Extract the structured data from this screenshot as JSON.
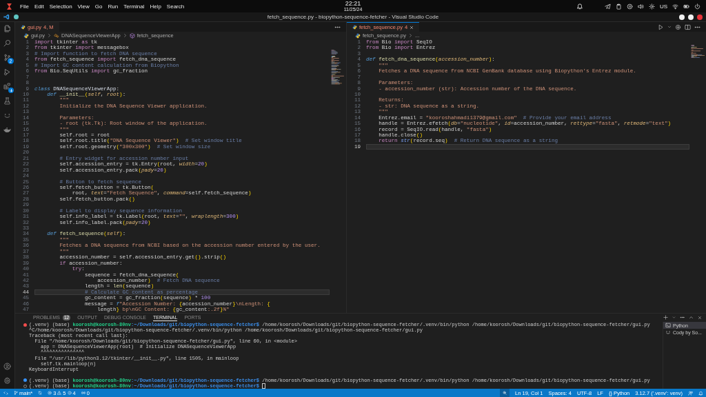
{
  "system_bar": {
    "menu": [
      "File",
      "Edit",
      "Selection",
      "View",
      "Go",
      "Run",
      "Terminal",
      "Help",
      "Search"
    ],
    "time": "22:21",
    "date": "11/25/24",
    "keyboard_layout": "US"
  },
  "window": {
    "title": "fetch_sequence.py - biopython-sequence-fetcher - Visual Studio Code"
  },
  "activity_bar": {
    "top": [
      {
        "kind": "files",
        "notice": false
      },
      {
        "kind": "search",
        "notice": false
      },
      {
        "kind": "source-control",
        "badge": "2",
        "notice": false
      },
      {
        "kind": "run-debug",
        "notice": false
      },
      {
        "kind": "extensions",
        "notice": true
      },
      {
        "kind": "testing",
        "notice": false
      },
      {
        "kind": "cody",
        "notice": false
      },
      {
        "kind": "docker",
        "notice": false
      }
    ],
    "bottom": [
      {
        "kind": "account"
      },
      {
        "kind": "settings"
      }
    ]
  },
  "editors": [
    {
      "focused": false,
      "tab": {
        "label": "gui.py",
        "status": "4, M",
        "has_errors": true
      },
      "actions": [
        {
          "kind": "more"
        }
      ],
      "breadcrumbs": [
        {
          "kind": "file",
          "text": "gui.py"
        },
        {
          "kind": "class",
          "text": "DNASequenceViewerApp"
        },
        {
          "kind": "method",
          "text": "fetch_sequence"
        }
      ],
      "lines": [
        {
          "number": "1",
          "current": false,
          "tokens": [
            {
              "kind": "kw",
              "text": "import"
            },
            {
              "kind": "txt",
              "text": " tkinter "
            },
            {
              "kind": "kw",
              "text": "as"
            },
            {
              "kind": "txt",
              "text": " tk"
            }
          ]
        },
        {
          "number": "2",
          "current": false,
          "tokens": [
            {
              "kind": "kw",
              "text": "from"
            },
            {
              "kind": "txt",
              "text": " tkinter "
            },
            {
              "kind": "kw",
              "text": "import"
            },
            {
              "kind": "txt",
              "text": " messagebox"
            }
          ]
        },
        {
          "number": "3",
          "current": false,
          "tokens": [
            {
              "kind": "com",
              "text": "# Import function to fetch DNA sequence"
            }
          ]
        },
        {
          "number": "4",
          "current": false,
          "tokens": [
            {
              "kind": "kw",
              "text": "from"
            },
            {
              "kind": "txt",
              "text": " fetch_sequence "
            },
            {
              "kind": "kw",
              "text": "import"
            },
            {
              "kind": "txt",
              "text": " fetch_dna_sequence"
            }
          ]
        },
        {
          "number": "5",
          "current": false,
          "tokens": [
            {
              "kind": "com",
              "text": "# Import GC content calculation from Biopython"
            }
          ]
        },
        {
          "number": "6",
          "current": false,
          "tokens": [
            {
              "kind": "kw",
              "text": "from"
            },
            {
              "kind": "txt",
              "text": " Bio.SeqUtils "
            },
            {
              "kind": "kw",
              "text": "import"
            },
            {
              "kind": "txt",
              "text": " gc_fraction"
            }
          ]
        },
        {
          "number": "7",
          "current": false
        },
        {
          "number": "8",
          "current": false
        },
        {
          "number": "9",
          "current": false,
          "tokens": [
            {
              "kind": "def",
              "text": "class"
            },
            {
              "kind": "cls",
              "text": " DNASequenceViewerApp"
            },
            {
              "kind": "txt",
              "text": ":"
            }
          ]
        },
        {
          "number": "10",
          "current": false,
          "tokens": [
            {
              "kind": "def",
              "text": "    def"
            },
            {
              "kind": "fn",
              "text": " __init__"
            },
            {
              "kind": "br",
              "text": "("
            },
            {
              "kind": "param",
              "text": "self"
            },
            {
              "kind": "txt",
              "text": ", "
            },
            {
              "kind": "param",
              "text": "root"
            },
            {
              "kind": "br",
              "text": ")"
            },
            {
              "kind": "txt",
              "text": ":"
            }
          ]
        },
        {
          "number": "11",
          "current": false,
          "tokens": [
            {
              "kind": "str",
              "text": "        \"\"\""
            }
          ]
        },
        {
          "number": "12",
          "current": false,
          "tokens": [
            {
              "kind": "str",
              "text": "        Initialize the DNA Sequence Viewer application."
            }
          ]
        },
        {
          "number": "13",
          "current": false
        },
        {
          "number": "14",
          "current": false,
          "tokens": [
            {
              "kind": "str",
              "text": "        Parameters:"
            }
          ]
        },
        {
          "number": "15",
          "current": false,
          "tokens": [
            {
              "kind": "str",
              "text": "        - root (tk.Tk): Root window of the application."
            }
          ]
        },
        {
          "number": "16",
          "current": false,
          "tokens": [
            {
              "kind": "str",
              "text": "        \"\"\""
            }
          ]
        },
        {
          "number": "17",
          "current": false,
          "tokens": [
            {
              "kind": "txt",
              "text": "        self.root = root"
            }
          ]
        },
        {
          "number": "18",
          "current": false,
          "tokens": [
            {
              "kind": "txt",
              "text": "        self.root.title"
            },
            {
              "kind": "br",
              "text": "("
            },
            {
              "kind": "str",
              "text": "\"DNA Sequence Viewer\""
            },
            {
              "kind": "br",
              "text": ")"
            },
            {
              "kind": "com",
              "text": "  # Set window title"
            }
          ]
        },
        {
          "number": "19",
          "current": false,
          "tokens": [
            {
              "kind": "txt",
              "text": "        self.root.geometry"
            },
            {
              "kind": "br",
              "text": "("
            },
            {
              "kind": "str",
              "text": "\"300x300\""
            },
            {
              "kind": "br",
              "text": ")"
            },
            {
              "kind": "com",
              "text": "  # Set window size"
            }
          ]
        },
        {
          "number": "20",
          "current": false
        },
        {
          "number": "21",
          "current": false,
          "tokens": [
            {
              "kind": "com",
              "text": "        # Entry widget for accession number input"
            }
          ]
        },
        {
          "number": "22",
          "current": false,
          "tokens": [
            {
              "kind": "txt",
              "text": "        self.accession_entry = tk.Entry"
            },
            {
              "kind": "br",
              "text": "("
            },
            {
              "kind": "txt",
              "text": "root, "
            },
            {
              "kind": "param",
              "text": "width"
            },
            {
              "kind": "txt",
              "text": "="
            },
            {
              "kind": "num",
              "text": "20"
            },
            {
              "kind": "br",
              "text": ")"
            }
          ]
        },
        {
          "number": "23",
          "current": false,
          "tokens": [
            {
              "kind": "txt",
              "text": "        self.accession_entry.pack"
            },
            {
              "kind": "br",
              "text": "("
            },
            {
              "kind": "param",
              "text": "pady"
            },
            {
              "kind": "txt",
              "text": "="
            },
            {
              "kind": "num",
              "text": "20"
            },
            {
              "kind": "br",
              "text": ")"
            }
          ]
        },
        {
          "number": "24",
          "current": false
        },
        {
          "number": "25",
          "current": false,
          "tokens": [
            {
              "kind": "com",
              "text": "        # Button to fetch sequence"
            }
          ]
        },
        {
          "number": "26",
          "current": false,
          "tokens": [
            {
              "kind": "txt",
              "text": "        self.fetch_button = tk.Button"
            },
            {
              "kind": "br",
              "text": "("
            }
          ]
        },
        {
          "number": "27",
          "current": false,
          "tokens": [
            {
              "kind": "txt",
              "text": "            root, "
            },
            {
              "kind": "param",
              "text": "text"
            },
            {
              "kind": "txt",
              "text": "="
            },
            {
              "kind": "str",
              "text": "\"Fetch Sequence\""
            },
            {
              "kind": "txt",
              "text": ", "
            },
            {
              "kind": "param",
              "text": "command"
            },
            {
              "kind": "txt",
              "text": "=self.fetch_sequence"
            },
            {
              "kind": "br",
              "text": ")"
            }
          ]
        },
        {
          "number": "28",
          "current": false,
          "tokens": [
            {
              "kind": "txt",
              "text": "        self.fetch_button.pack"
            },
            {
              "kind": "br",
              "text": "()"
            }
          ]
        },
        {
          "number": "29",
          "current": false
        },
        {
          "number": "30",
          "current": false,
          "tokens": [
            {
              "kind": "com",
              "text": "        # Label to display sequence information"
            }
          ]
        },
        {
          "number": "31",
          "current": false,
          "tokens": [
            {
              "kind": "txt",
              "text": "        self.info_label = tk.Label"
            },
            {
              "kind": "br",
              "text": "("
            },
            {
              "kind": "txt",
              "text": "root, "
            },
            {
              "kind": "param",
              "text": "text"
            },
            {
              "kind": "txt",
              "text": "="
            },
            {
              "kind": "str",
              "text": "\"\""
            },
            {
              "kind": "txt",
              "text": ", "
            },
            {
              "kind": "param",
              "text": "wraplength"
            },
            {
              "kind": "txt",
              "text": "="
            },
            {
              "kind": "num",
              "text": "300"
            },
            {
              "kind": "br",
              "text": ")"
            }
          ]
        },
        {
          "number": "32",
          "current": false,
          "tokens": [
            {
              "kind": "txt",
              "text": "        self.info_label.pack"
            },
            {
              "kind": "br",
              "text": "("
            },
            {
              "kind": "param",
              "text": "pady"
            },
            {
              "kind": "txt",
              "text": "="
            },
            {
              "kind": "num",
              "text": "20"
            },
            {
              "kind": "br",
              "text": ")"
            }
          ]
        },
        {
          "number": "33",
          "current": false
        },
        {
          "number": "34",
          "current": false,
          "tokens": [
            {
              "kind": "def",
              "text": "    def"
            },
            {
              "kind": "fn",
              "text": " fetch_sequence"
            },
            {
              "kind": "br",
              "text": "("
            },
            {
              "kind": "param",
              "text": "self"
            },
            {
              "kind": "br",
              "text": ")"
            },
            {
              "kind": "txt",
              "text": ":"
            }
          ]
        },
        {
          "number": "35",
          "current": false,
          "tokens": [
            {
              "kind": "str",
              "text": "        \"\"\""
            }
          ]
        },
        {
          "number": "36",
          "current": false,
          "tokens": [
            {
              "kind": "str",
              "text": "        Fetches a DNA sequence from NCBI based on the accession number entered by the user."
            }
          ]
        },
        {
          "number": "37",
          "current": false,
          "tokens": [
            {
              "kind": "str",
              "text": "        \"\"\""
            }
          ]
        },
        {
          "number": "38",
          "current": false,
          "tokens": [
            {
              "kind": "txt",
              "text": "        accession_number = self.accession_entry.get"
            },
            {
              "kind": "br",
              "text": "()"
            },
            {
              "kind": "txt",
              "text": ".strip"
            },
            {
              "kind": "br",
              "text": "()"
            }
          ]
        },
        {
          "number": "39",
          "current": false,
          "tokens": [
            {
              "kind": "kw",
              "text": "        if"
            },
            {
              "kind": "txt",
              "text": " accession_number:"
            }
          ]
        },
        {
          "number": "40",
          "current": false,
          "tokens": [
            {
              "kind": "kw",
              "text": "            try"
            },
            {
              "kind": "txt",
              "text": ":"
            }
          ]
        },
        {
          "number": "41",
          "current": false,
          "tokens": [
            {
              "kind": "txt",
              "text": "                sequence = fetch_dna_sequence"
            },
            {
              "kind": "br",
              "text": "("
            }
          ]
        },
        {
          "number": "42",
          "current": false,
          "tokens": [
            {
              "kind": "txt",
              "text": "                    accession_number"
            },
            {
              "kind": "br",
              "text": ")"
            },
            {
              "kind": "com",
              "text": "  # Fetch DNA sequence"
            }
          ]
        },
        {
          "number": "43",
          "current": false,
          "tokens": [
            {
              "kind": "txt",
              "text": "                length = "
            },
            {
              "kind": "fn",
              "text": "len"
            },
            {
              "kind": "br",
              "text": "("
            },
            {
              "kind": "txt",
              "text": "sequence"
            },
            {
              "kind": "br",
              "text": ")"
            }
          ]
        },
        {
          "number": "44",
          "current": true,
          "tokens": [
            {
              "kind": "com",
              "text": "                # Calculate GC content as percentage"
            }
          ]
        },
        {
          "number": "45",
          "current": false,
          "tokens": [
            {
              "kind": "txt",
              "text": "                gc_content = gc_fraction"
            },
            {
              "kind": "br",
              "text": "("
            },
            {
              "kind": "txt",
              "text": "sequence"
            },
            {
              "kind": "br",
              "text": ")"
            },
            {
              "kind": "txt",
              "text": " * "
            },
            {
              "kind": "num",
              "text": "100"
            }
          ]
        },
        {
          "number": "46",
          "current": false,
          "tokens": [
            {
              "kind": "txt",
              "text": "                message = "
            },
            {
              "kind": "def",
              "text": "f"
            },
            {
              "kind": "str",
              "text": "\"Accession Number: "
            },
            {
              "kind": "br",
              "text": "{"
            },
            {
              "kind": "txt",
              "text": "accession_number"
            },
            {
              "kind": "br",
              "text": "}"
            },
            {
              "kind": "str",
              "text": "\\nLength: "
            },
            {
              "kind": "br",
              "text": "{"
            }
          ]
        },
        {
          "number": "47",
          "current": false,
          "tokens": [
            {
              "kind": "txt",
              "text": "                    length"
            },
            {
              "kind": "br",
              "text": "}"
            },
            {
              "kind": "str",
              "text": " bp\\nGC Content: "
            },
            {
              "kind": "br",
              "text": "{"
            },
            {
              "kind": "txt",
              "text": "gc_content"
            },
            {
              "kind": "str",
              "text": ":.2f"
            },
            {
              "kind": "br",
              "text": "}"
            },
            {
              "kind": "str",
              "text": "%\""
            }
          ]
        }
      ]
    },
    {
      "focused": true,
      "tab": {
        "label": "fetch_sequence.py",
        "status": "4",
        "has_errors": true
      },
      "actions": [
        {
          "kind": "run"
        },
        {
          "kind": "caret"
        },
        {
          "kind": "compare"
        },
        {
          "kind": "split"
        },
        {
          "kind": "more"
        }
      ],
      "breadcrumbs": [
        {
          "kind": "file",
          "text": "fetch_sequence.py"
        },
        {
          "kind": "more",
          "text": "..."
        }
      ],
      "lines": [
        {
          "number": "1",
          "current": false,
          "tokens": [
            {
              "kind": "kw",
              "text": "from"
            },
            {
              "kind": "txt",
              "text": " Bio "
            },
            {
              "kind": "kw",
              "text": "import"
            },
            {
              "kind": "txt",
              "text": " SeqIO"
            }
          ]
        },
        {
          "number": "2",
          "current": false,
          "tokens": [
            {
              "kind": "kw",
              "text": "from"
            },
            {
              "kind": "txt",
              "text": " Bio "
            },
            {
              "kind": "kw",
              "text": "import"
            },
            {
              "kind": "txt",
              "text": " Entrez"
            }
          ]
        },
        {
          "number": "3",
          "current": false
        },
        {
          "number": "4",
          "current": false,
          "tokens": [
            {
              "kind": "def",
              "text": "def"
            },
            {
              "kind": "fn",
              "text": " fetch_dna_sequence"
            },
            {
              "kind": "br",
              "text": "("
            },
            {
              "kind": "param",
              "text": "accession_number"
            },
            {
              "kind": "br",
              "text": ")"
            },
            {
              "kind": "txt",
              "text": ":"
            }
          ]
        },
        {
          "number": "5",
          "current": false,
          "tokens": [
            {
              "kind": "str",
              "text": "    \"\"\""
            }
          ]
        },
        {
          "number": "6",
          "current": false,
          "tokens": [
            {
              "kind": "str",
              "text": "    Fetches a DNA sequence from NCBI GenBank database using Biopython's Entrez module."
            }
          ]
        },
        {
          "number": "7",
          "current": false
        },
        {
          "number": "8",
          "current": false,
          "tokens": [
            {
              "kind": "str",
              "text": "    Parameters:"
            }
          ]
        },
        {
          "number": "9",
          "current": false,
          "tokens": [
            {
              "kind": "str",
              "text": "    - accession_number (str): Accession number of the DNA sequence."
            }
          ]
        },
        {
          "number": "10",
          "current": false
        },
        {
          "number": "11",
          "current": false,
          "tokens": [
            {
              "kind": "str",
              "text": "    Returns:"
            }
          ]
        },
        {
          "number": "12",
          "current": false,
          "tokens": [
            {
              "kind": "str",
              "text": "    - str: DNA sequence as a string."
            }
          ]
        },
        {
          "number": "13",
          "current": false,
          "tokens": [
            {
              "kind": "str",
              "text": "    \"\"\""
            }
          ]
        },
        {
          "number": "14",
          "current": false,
          "tokens": [
            {
              "kind": "txt",
              "text": "    Entrez.email = "
            },
            {
              "kind": "str",
              "text": "\"kooroshahmadi1379@gmail.com\""
            },
            {
              "kind": "com",
              "text": "  # Provide your email address"
            }
          ]
        },
        {
          "number": "15",
          "current": false,
          "tokens": [
            {
              "kind": "txt",
              "text": "    handle = Entrez.efetch"
            },
            {
              "kind": "br",
              "text": "("
            },
            {
              "kind": "param",
              "text": "db"
            },
            {
              "kind": "txt",
              "text": "="
            },
            {
              "kind": "str",
              "text": "\"nucleotide\""
            },
            {
              "kind": "txt",
              "text": ", "
            },
            {
              "kind": "param",
              "text": "id"
            },
            {
              "kind": "txt",
              "text": "=accession_number, "
            },
            {
              "kind": "param",
              "text": "rettype"
            },
            {
              "kind": "txt",
              "text": "="
            },
            {
              "kind": "str",
              "text": "\"fasta\""
            },
            {
              "kind": "txt",
              "text": ", "
            },
            {
              "kind": "param",
              "text": "retmode"
            },
            {
              "kind": "txt",
              "text": "="
            },
            {
              "kind": "str",
              "text": "\"text\""
            },
            {
              "kind": "br",
              "text": ")"
            }
          ]
        },
        {
          "number": "16",
          "current": false,
          "tokens": [
            {
              "kind": "txt",
              "text": "    record = SeqIO.read"
            },
            {
              "kind": "br",
              "text": "("
            },
            {
              "kind": "txt",
              "text": "handle, "
            },
            {
              "kind": "str",
              "text": "\"fasta\""
            },
            {
              "kind": "br",
              "text": ")"
            }
          ]
        },
        {
          "number": "17",
          "current": false,
          "tokens": [
            {
              "kind": "txt",
              "text": "    handle.close"
            },
            {
              "kind": "br",
              "text": "()"
            }
          ]
        },
        {
          "number": "18",
          "current": false,
          "tokens": [
            {
              "kind": "kw",
              "text": "    return"
            },
            {
              "kind": "builtin",
              "text": " str"
            },
            {
              "kind": "br",
              "text": "("
            },
            {
              "kind": "txt",
              "text": "record.seq"
            },
            {
              "kind": "br",
              "text": ")"
            },
            {
              "kind": "com",
              "text": "  # Return DNA sequence as a string"
            }
          ]
        },
        {
          "number": "19",
          "current": true
        }
      ]
    }
  ],
  "panel": {
    "tabs": [
      {
        "label": "PROBLEMS",
        "badge": "12",
        "selected": false
      },
      {
        "label": "OUTPUT",
        "selected": false
      },
      {
        "label": "DEBUG CONSOLE",
        "selected": false
      },
      {
        "label": "TERMINAL",
        "selected": true
      },
      {
        "label": "PORTS",
        "selected": false
      }
    ],
    "terminal": {
      "lines": [
        {
          "kind": "prompt",
          "marker": {
            "kind": "error"
          },
          "cursor": false,
          "env": "(.venv) (base)",
          "user": "koorosh@koorosh-80nv",
          "path": ":~/Downloads/git/biopython-sequence-fetcher$",
          "command": "/home/koorosh/Downloads/git/biopython-sequence-fetcher/.venv/bin/python /home/koorosh/Downloads/git/biopython-sequence-fetcher/gui.py"
        },
        {
          "kind": "output",
          "text": "^C/home/koorosh/Downloads/git/biopython-sequence-fetcher/.venv/bin/python /home/koorosh/Downloads/git/biopython-sequence-fetcher/gui.py"
        },
        {
          "kind": "output",
          "text": "Traceback (most recent call last):"
        },
        {
          "kind": "output",
          "text": "  File \"/home/koorosh/Downloads/git/biopython-sequence-fetcher/gui.py\", line 60, in <module>"
        },
        {
          "kind": "output",
          "text": "    app = DNASequenceViewerApp(root)  # Initialize DNASequenceViewerApp"
        },
        {
          "kind": "output",
          "text": "    ^^^^^^^^^^^^^^^"
        },
        {
          "kind": "output",
          "text": "  File \"/usr/lib/python3.12/tkinter/__init__.py\", line 1505, in mainloop"
        },
        {
          "kind": "output",
          "text": "    self.tk.mainloop(n)"
        },
        {
          "kind": "output",
          "text": "KeyboardInterrupt"
        },
        {
          "kind": "blank"
        },
        {
          "kind": "prompt",
          "marker": {
            "kind": "success"
          },
          "cursor": false,
          "env": "(.venv) (base)",
          "user": "koorosh@koorosh-80nv",
          "path": ":~/Downloads/git/biopython-sequence-fetcher$",
          "command": "/home/koorosh/Downloads/git/biopython-sequence-fetcher/.venv/bin/python /home/koorosh/Downloads/git/biopython-sequence-fetcher/gui.py"
        },
        {
          "kind": "prompt",
          "marker": {
            "kind": "idle"
          },
          "cursor": true,
          "env": "(.venv) (base)",
          "user": "koorosh@koorosh-80nv",
          "path": ":~/Downloads/git/biopython-sequence-fetcher$"
        }
      ]
    },
    "instances": [
      {
        "kind": "shell",
        "label": "Python",
        "selected": true
      },
      {
        "kind": "cody",
        "label": "Cody by So...",
        "selected": false
      }
    ]
  },
  "status_bar": {
    "branch": "main*",
    "errors": "3",
    "warnings": "5",
    "infos": "4",
    "ports": "0",
    "items": [
      "Ln 19, Col 1",
      "Spaces: 4",
      "UTF-8",
      "LF"
    ],
    "language_icon": "{}",
    "language": "Python",
    "interpreter": "3.12.7 ('.venv': venv)"
  }
}
